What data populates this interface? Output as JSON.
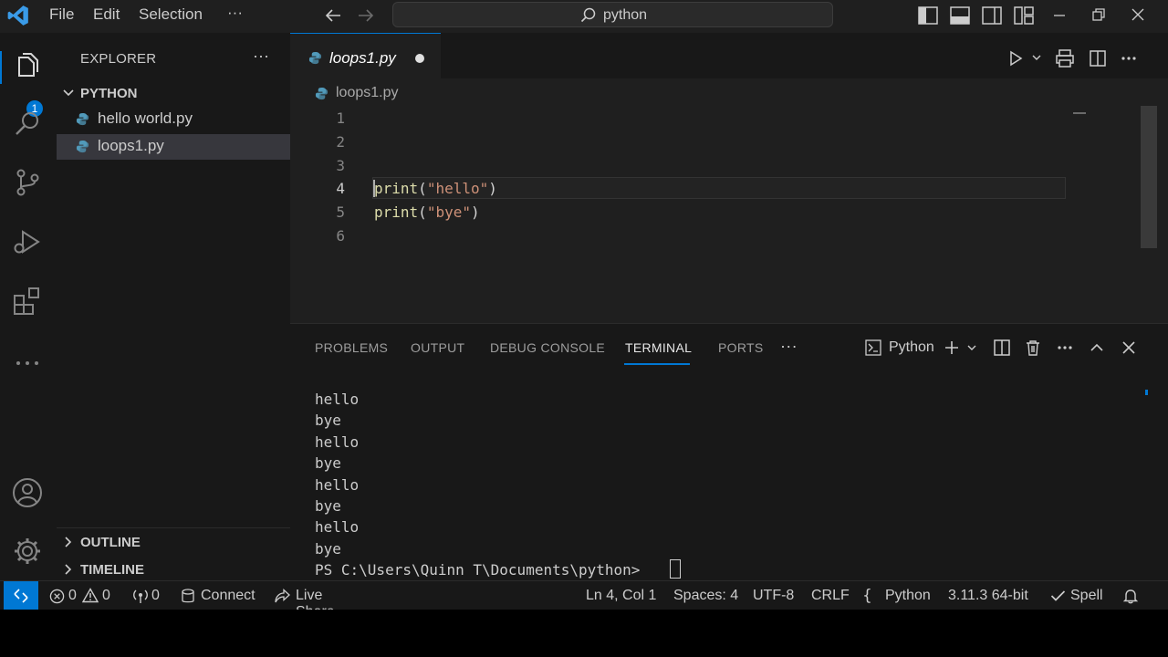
{
  "menu": {
    "file": "File",
    "edit": "Edit",
    "selection": "Selection",
    "more": "···"
  },
  "command_center": {
    "text": "python"
  },
  "activity": {
    "explorer_badge": "1"
  },
  "sidebar": {
    "title": "EXPLORER",
    "more": "···",
    "folder": "PYTHON",
    "files": [
      "hello world.py",
      "loops1.py"
    ],
    "outline": "OUTLINE",
    "timeline": "TIMELINE"
  },
  "editor": {
    "tab_label": "loops1.py",
    "breadcrumb": "loops1.py",
    "line_numbers": [
      "1",
      "2",
      "3",
      "4",
      "5",
      "6"
    ],
    "code": {
      "line4_fn": "print",
      "line4_open": "(",
      "line4_str": "\"hello\"",
      "line4_close": ")",
      "line5_fn": "print",
      "line5_open": "(",
      "line5_str": "\"bye\"",
      "line5_close": ")"
    }
  },
  "panel": {
    "tabs": {
      "problems": "PROBLEMS",
      "output": "OUTPUT",
      "debug": "DEBUG CONSOLE",
      "terminal": "TERMINAL",
      "ports": "PORTS",
      "more": "···"
    },
    "terminal_profile": "Python",
    "terminal_lines": [
      "hello",
      "bye",
      "hello",
      "bye",
      "hello",
      "bye",
      "hello",
      "bye"
    ],
    "prompt": "PS C:\\Users\\Quinn T\\Documents\\python> "
  },
  "status": {
    "errors": "0",
    "warnings": "0",
    "ports": "0",
    "connect": "Connect",
    "live_share": "Live Share",
    "position": "Ln 4, Col 1",
    "spaces": "Spaces: 4",
    "encoding": "UTF-8",
    "eol": "CRLF",
    "language": "Python",
    "interpreter": "3.11.3 64-bit",
    "spell": "Spell"
  },
  "colors": {
    "accent": "#0078d4",
    "background": "#1f1f1f",
    "sidebar": "#181818",
    "function": "#dcdcaa",
    "string": "#ce9178"
  }
}
